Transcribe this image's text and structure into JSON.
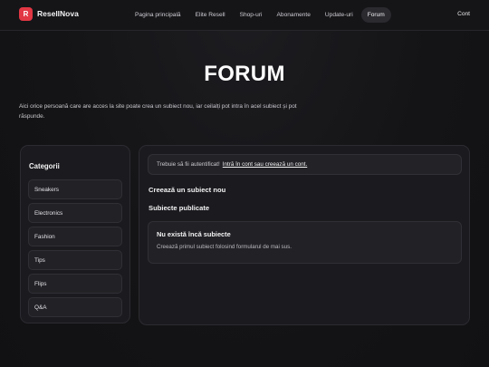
{
  "navbar": {
    "logo_letter": "R",
    "brand": "ResellNova",
    "links": [
      {
        "label": "Pagina principală"
      },
      {
        "label": "Elite Resell"
      },
      {
        "label": "Shop-uri"
      },
      {
        "label": "Abonamente"
      },
      {
        "label": "Update-uri"
      },
      {
        "label": "Forum",
        "active": true
      }
    ],
    "account_label": "Cont"
  },
  "hero": {
    "title": "FORUM",
    "description": "Aici orice persoană care are acces la site poate crea un subiect nou, iar ceilalți pot intra în acel subiect și pot răspunde."
  },
  "sidebar": {
    "title": "Categorii",
    "categories": [
      "Sneakers",
      "Electronics",
      "Fashion",
      "Tips",
      "Flips",
      "Q&A"
    ]
  },
  "main": {
    "alert_text": "Trebuie să fii autentificat!",
    "alert_link": "Intră în cont sau creează un cont.",
    "create_title": "Creează un subiect nou",
    "published_title": "Subiecte publicate",
    "empty_title": "Nu există încă subiecte",
    "empty_desc": "Creează primul subiect folosind formularul de mai sus."
  },
  "colors": {
    "accent": "#e23744",
    "background": "#141416",
    "panel": "#1b1b1f"
  }
}
